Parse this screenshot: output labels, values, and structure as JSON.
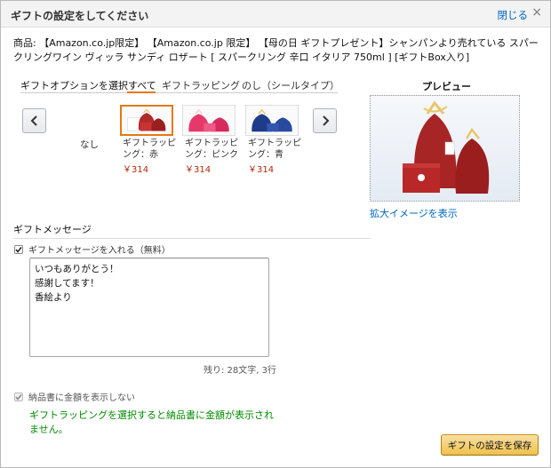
{
  "dialog": {
    "title": "ギフトの設定をしてください",
    "close_label": "閉じる",
    "close_icon": "×"
  },
  "product": {
    "text": "商品: 【Amazon.co.jp限定】 【Amazon.co.jp 限定】 【母の日 ギフトプレゼント】シャンパンより売れている スパークリングワイン ヴィッラ サンディ ロザート [ スパークリング 辛口 イタリア 750ml ] [ギフトBox入り]"
  },
  "tabs": {
    "label": "ギフトオプションを選択",
    "items": [
      "すべて",
      "ギフトラッピング",
      "のし（シールタイプ）"
    ],
    "active_index": 0
  },
  "carousel": {
    "prev_icon": "chevron-left-icon",
    "next_icon": "chevron-right-icon",
    "none_label": "なし",
    "options": [
      {
        "name": "ギフトラッピング：赤",
        "price": "￥314",
        "color": "#b22a2a",
        "selected": true
      },
      {
        "name": "ギフトラッピング：ピンク",
        "price": "￥314",
        "color": "#e5396b",
        "selected": false
      },
      {
        "name": "ギフトラッピング：青",
        "price": "￥314",
        "color": "#1f3c8c",
        "selected": false
      }
    ]
  },
  "preview": {
    "title": "プレビュー",
    "zoom_link": "拡大イメージを表示"
  },
  "message": {
    "heading": "ギフトメッセージ",
    "include_label": "ギフトメッセージを入れる（無料）",
    "include_checked": true,
    "text": "いつもありがとう！\n感謝してます！\n香絵より",
    "counter": "残り: 28文字, 3行"
  },
  "invoice": {
    "label": "納品書に金額を表示しない",
    "checked": true,
    "disabled": true,
    "notice": "ギフトラッピングを選択すると納品書に金額が表示されません。"
  },
  "actions": {
    "save_label": "ギフトの設定を保存"
  },
  "colors": {
    "accent": "#e47911",
    "link": "#0066c0",
    "price": "#b12704",
    "notice": "#008a00",
    "button": "#f0c14b"
  }
}
